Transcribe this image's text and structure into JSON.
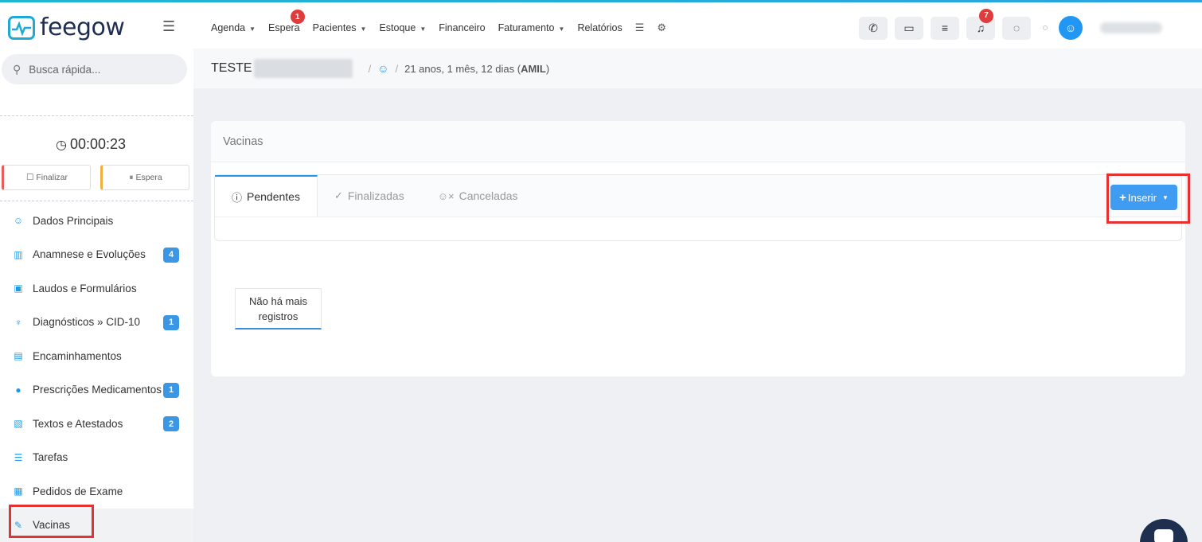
{
  "brand": {
    "name": "feegow"
  },
  "nav": {
    "items": [
      {
        "label": "Agenda",
        "dropdown": true
      },
      {
        "label": "Espera",
        "dropdown": false,
        "badge": "1"
      },
      {
        "label": "Pacientes",
        "dropdown": true
      },
      {
        "label": "Estoque",
        "dropdown": true
      },
      {
        "label": "Financeiro",
        "dropdown": false
      },
      {
        "label": "Faturamento",
        "dropdown": true
      },
      {
        "label": "Relatórios",
        "dropdown": false
      }
    ],
    "notifications_badge": "7"
  },
  "sidebar": {
    "search_placeholder": "Busca rápida...",
    "timer": "00:00:23",
    "finalizar_label": "Finalizar",
    "espera_label": "Espera",
    "items": [
      {
        "label": "Dados Principais",
        "icon": "user-icon"
      },
      {
        "label": "Anamnese e Evoluções",
        "icon": "chart-icon",
        "badge": "4"
      },
      {
        "label": "Laudos e Formulários",
        "icon": "clipboard-icon"
      },
      {
        "label": "Diagnósticos » CID-10",
        "icon": "stethoscope-icon",
        "badge": "1"
      },
      {
        "label": "Encaminhamentos",
        "icon": "file-icon"
      },
      {
        "label": "Prescrições Medicamentos",
        "icon": "pills-icon",
        "badge": "1"
      },
      {
        "label": "Textos e Atestados",
        "icon": "document-icon",
        "badge": "2"
      },
      {
        "label": "Tarefas",
        "icon": "tasks-icon"
      },
      {
        "label": "Pedidos de Exame",
        "icon": "hospital-icon"
      },
      {
        "label": "Vacinas",
        "icon": "syringe-icon",
        "active": true
      }
    ]
  },
  "breadcrumb": {
    "patient": "TESTE",
    "age": "21 anos, 1 mês, 12 dias",
    "plan": "AMIL"
  },
  "card": {
    "title": "Vacinas",
    "tabs": [
      {
        "label": "Pendentes",
        "active": true
      },
      {
        "label": "Finalizadas"
      },
      {
        "label": "Canceladas"
      }
    ],
    "insert_label": "Inserir",
    "empty_line1": "Não há mais",
    "empty_line2": "registros"
  },
  "colors": {
    "accent": "#2196f3",
    "badge_red": "#e03c3c",
    "highlight": "#e53131"
  }
}
